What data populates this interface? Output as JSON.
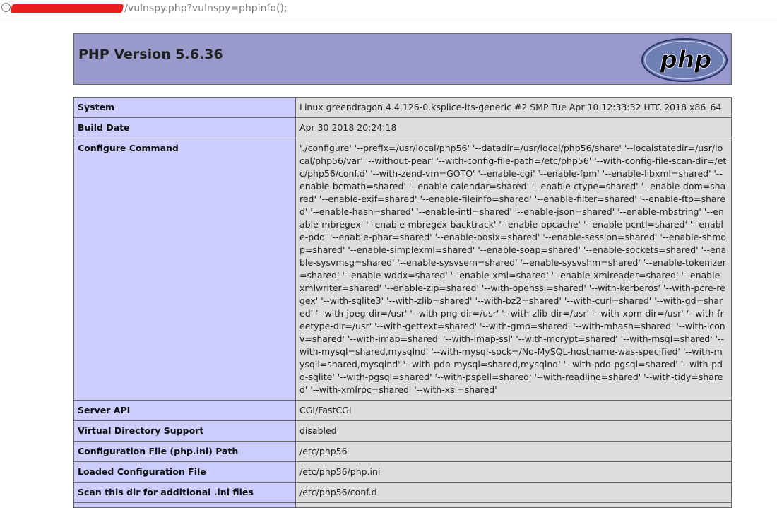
{
  "address_bar": {
    "host_visible": "v",
    "path": "/vulnspy.php?vulnspy=phpinfo();",
    "info_icon": "info-icon"
  },
  "header": {
    "title": "PHP Version 5.6.36",
    "logo_text": "php",
    "logo_icon": "php-logo"
  },
  "colors": {
    "header_bg": "#9999cc",
    "label_bg": "#ccccff",
    "value_bg": "#dddddd",
    "redaction": "#ec1d1d"
  },
  "rows": [
    {
      "label": "System",
      "value": "Linux greendragon 4.4.126-0.ksplice-lts-generic #2 SMP Tue Apr 10 12:33:32 UTC 2018 x86_64"
    },
    {
      "label": "Build Date",
      "value": "Apr 30 2018 20:24:18"
    },
    {
      "label": "Configure Command",
      "value": "'./configure' '--prefix=/usr/local/php56' '--datadir=/usr/local/php56/share' '--localstatedir=/usr/local/php56/var' '--without-pear' '--with-config-file-path=/etc/php56' '--with-config-file-scan-dir=/etc/php56/conf.d' '--with-zend-vm=GOTO' '--enable-cgi' '--enable-fpm' '--enable-libxml=shared' '--enable-bcmath=shared' '--enable-calendar=shared' '--enable-ctype=shared' '--enable-dom=shared' '--enable-exif=shared' '--enable-fileinfo=shared' '--enable-filter=shared' '--enable-ftp=shared' '--enable-hash=shared' '--enable-intl=shared' '--enable-json=shared' '--enable-mbstring' '--enable-mbregex' '--enable-mbregex-backtrack' '--enable-opcache' '--enable-pcntl=shared' '--enable-pdo' '--enable-phar=shared' '--enable-posix=shared' '--enable-session=shared' '--enable-shmop=shared' '--enable-simplexml=shared' '--enable-soap=shared' '--enable-sockets=shared' '--enable-sysvmsg=shared' '--enable-sysvsem=shared' '--enable-sysvshm=shared' '--enable-tokenizer=shared' '--enable-wddx=shared' '--enable-xml=shared' '--enable-xmlreader=shared' '--enable-xmlwriter=shared' '--enable-zip=shared' '--with-openssl=shared' '--with-kerberos' '--with-pcre-regex' '--with-sqlite3' '--with-zlib=shared' '--with-bz2=shared' '--with-curl=shared' '--with-gd=shared' '--with-jpeg-dir=/usr' '--with-png-dir=/usr' '--with-zlib-dir=/usr' '--with-xpm-dir=/usr' '--with-freetype-dir=/usr' '--with-gettext=shared' '--with-gmp=shared' '--with-mhash=shared' '--with-iconv=shared' '--with-imap=shared' '--with-imap-ssl' '--with-mcrypt=shared' '--with-msql=shared' '--with-mysql=shared,mysqlnd' '--with-mysql-sock=/No-MySQL-hostname-was-specified' '--with-mysqli=shared,mysqlnd' '--with-pdo-mysql=shared,mysqlnd' '--with-pdo-pgsql=shared' '--with-pdo-sqlite' '--with-pgsql=shared' '--with-pspell=shared' '--with-readline=shared' '--with-tidy=shared' '--with-xmlrpc=shared' '--with-xsl=shared'"
    },
    {
      "label": "Server API",
      "value": "CGI/FastCGI"
    },
    {
      "label": "Virtual Directory Support",
      "value": "disabled"
    },
    {
      "label": "Configuration File (php.ini) Path",
      "value": "/etc/php56"
    },
    {
      "label": "Loaded Configuration File",
      "value": "/etc/php56/php.ini"
    },
    {
      "label": "Scan this dir for additional .ini files",
      "value": "/etc/php56/conf.d"
    }
  ]
}
